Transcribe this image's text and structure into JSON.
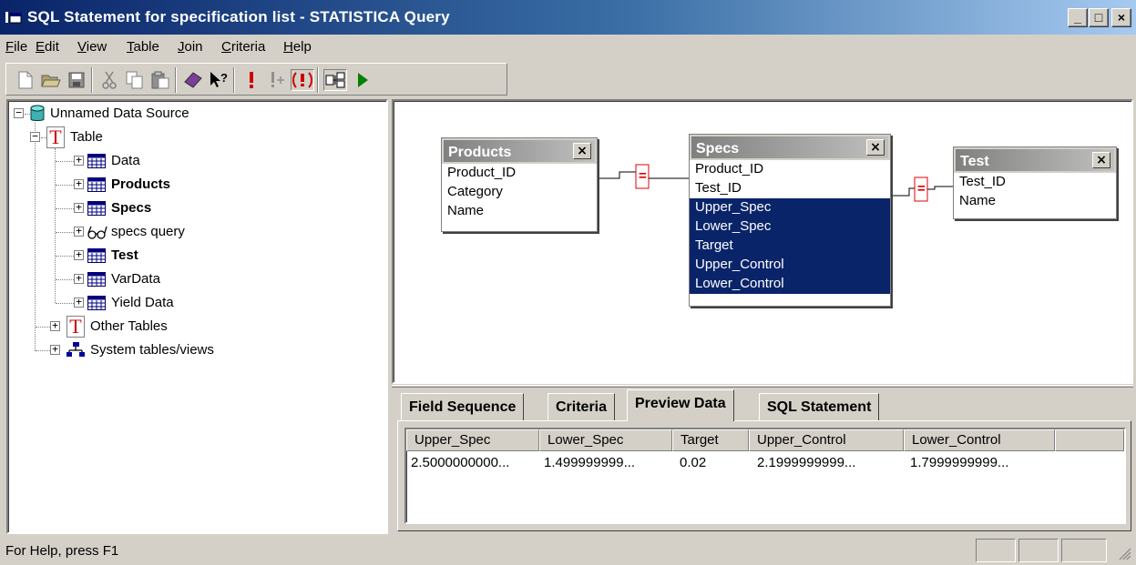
{
  "window": {
    "title": "SQL Statement for specification list - STATISTICA Query",
    "minimize": "_",
    "maximize": "□",
    "close": "×"
  },
  "menu": [
    {
      "key": "F",
      "rest": "ile"
    },
    {
      "key": "E",
      "rest": "dit"
    },
    {
      "key": "V",
      "rest": "iew"
    },
    {
      "key": "T",
      "rest": "able"
    },
    {
      "key": "J",
      "rest": "oin"
    },
    {
      "key": "C",
      "rest": "riteria"
    },
    {
      "key": "H",
      "rest": "elp"
    }
  ],
  "toolbar": {
    "icons": [
      "new-icon",
      "open-icon",
      "save-icon",
      "cut-icon",
      "copy-icon",
      "paste-icon",
      "add-table-icon",
      "help-pointer-icon",
      "execute-icon",
      "execute-append-icon",
      "auto-execute-icon",
      "diagram-icon",
      "run-icon"
    ],
    "colors": {
      "exec": "#cc0000",
      "run": "#008000"
    }
  },
  "tree": {
    "root": "Unnamed Data Source",
    "table_group": "Table",
    "tables": [
      {
        "label": "Data",
        "bold": false
      },
      {
        "label": "Products",
        "bold": true
      },
      {
        "label": "Specs",
        "bold": true
      },
      {
        "label": "specs query",
        "bold": false
      },
      {
        "label": "Test",
        "bold": true
      },
      {
        "label": "VarData",
        "bold": false
      },
      {
        "label": "Yield Data",
        "bold": false
      }
    ],
    "other_tables": "Other Tables",
    "system_tables": "System tables/views"
  },
  "diagram": {
    "products": {
      "title": "Products",
      "fields": [
        "Product_ID",
        "Category",
        "Name"
      ]
    },
    "specs": {
      "title": "Specs",
      "fields": [
        "Product_ID",
        "Test_ID",
        "Upper_Spec",
        "Lower_Spec",
        "Target",
        "Upper_Control",
        "Lower_Control"
      ]
    },
    "test": {
      "title": "Test",
      "fields": [
        "Test_ID",
        "Name"
      ]
    },
    "join_symbol": "="
  },
  "tabs": [
    "Field Sequence",
    "Criteria",
    "Preview Data",
    "SQL Statement"
  ],
  "active_tab": "Preview Data",
  "preview": {
    "columns": [
      "Upper_Spec",
      "Lower_Spec",
      "Target",
      "Upper_Control",
      "Lower_Control"
    ],
    "rows": [
      [
        "2.5000000000...",
        "1.499999999...",
        "0.02",
        "2.1999999999...",
        "1.7999999999..."
      ]
    ]
  },
  "status": {
    "text": "For Help, press F1"
  },
  "colors": {
    "titlebar": "#0a246a",
    "selection": "#0a246a",
    "face": "#d4d0c8"
  }
}
